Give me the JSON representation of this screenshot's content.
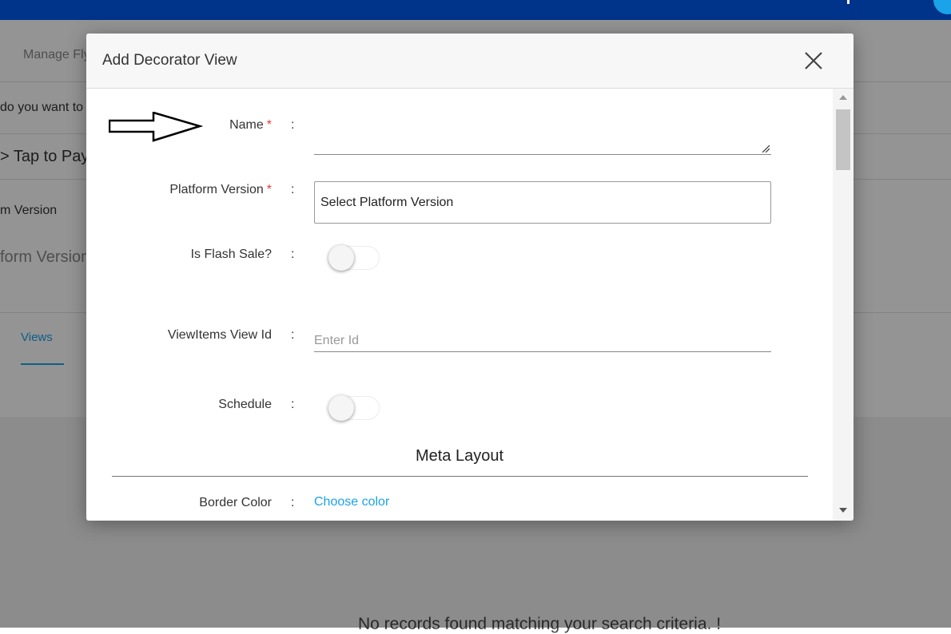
{
  "background": {
    "breadcrumb": "Manage Fly",
    "question": "do you want to",
    "section_heading": "> Tap to Pay",
    "version_label": "m Version",
    "version_value": "form Version",
    "tab_views": "Views",
    "empty_message": "No records found matching your search criteria. !"
  },
  "modal": {
    "title": "Add Decorator View",
    "colon": ":",
    "fields": {
      "name": {
        "label": "Name",
        "required_mark": "*",
        "value": ""
      },
      "platform_version": {
        "label": "Platform Version",
        "required_mark": "*",
        "selected": "Select Platform Version"
      },
      "flash_sale": {
        "label": "Is Flash Sale?",
        "checked": false
      },
      "view_items_view_id": {
        "label": "ViewItems View Id",
        "placeholder": "Enter Id",
        "value": ""
      },
      "schedule": {
        "label": "Schedule",
        "checked": false
      }
    },
    "meta_layout": {
      "title": "Meta Layout",
      "border_color": {
        "label": "Border Color",
        "action": "Choose color"
      }
    }
  },
  "colors": {
    "topbar": "#00338a",
    "accent": "#1aa3e8",
    "required": "#e53935"
  },
  "icons": [
    "close-icon",
    "annotation-arrow-icon",
    "resize-grip-icon",
    "scroll-up-icon",
    "scroll-down-icon"
  ]
}
